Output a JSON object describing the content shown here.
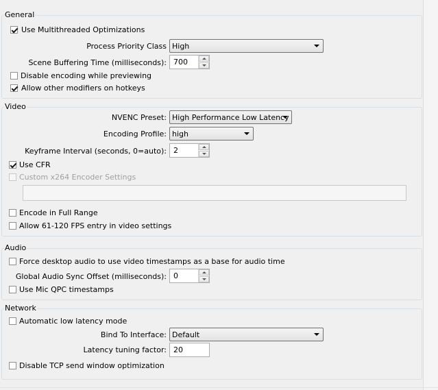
{
  "general": {
    "title": "General",
    "use_multithreaded_label": "Use Multithreaded Optimizations",
    "process_priority_label": "Process Priority Class",
    "process_priority_value": "High",
    "scene_buffering_label": "Scene Buffering Time (milliseconds):",
    "scene_buffering_value": "700",
    "disable_encoding_label": "Disable encoding while previewing",
    "allow_modifiers_label": "Allow other modifiers on hotkeys"
  },
  "video": {
    "title": "Video",
    "nvenc_preset_label": "NVENC Preset:",
    "nvenc_preset_value": "High Performance Low Latency",
    "encoding_profile_label": "Encoding Profile:",
    "encoding_profile_value": "high",
    "keyframe_label": "Keyframe Interval (seconds, 0=auto):",
    "keyframe_value": "2",
    "use_cfr_label": "Use CFR",
    "custom_x264_label": "Custom x264 Encoder Settings",
    "encode_full_range_label": "Encode in Full Range",
    "allow_fps_label": "Allow 61-120 FPS entry in video settings"
  },
  "audio": {
    "title": "Audio",
    "force_desktop_label": "Force desktop audio to use video timestamps as a base for audio time",
    "sync_offset_label": "Global Audio Sync Offset (milliseconds):",
    "sync_offset_value": "0",
    "mic_qpc_label": "Use Mic QPC timestamps"
  },
  "network": {
    "title": "Network",
    "low_latency_label": "Automatic low latency mode",
    "bind_interface_label": "Bind To Interface:",
    "bind_interface_value": "Default",
    "latency_factor_label": "Latency tuning factor:",
    "latency_factor_value": "20",
    "disable_tcp_label": "Disable TCP send window optimization"
  }
}
